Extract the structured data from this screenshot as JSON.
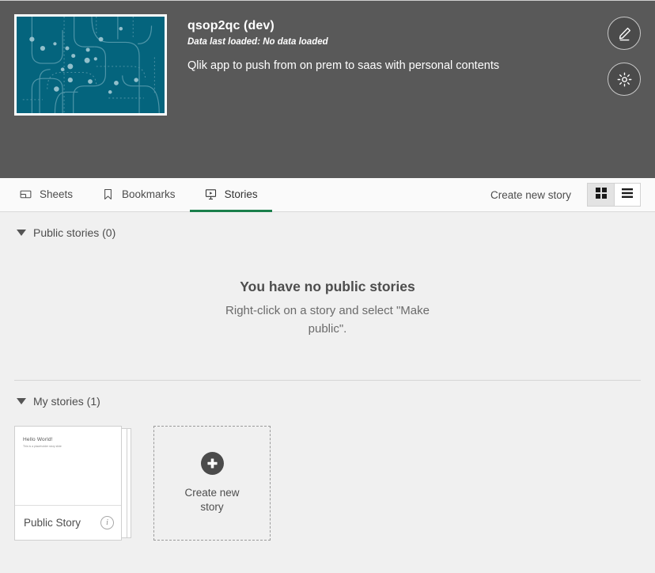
{
  "app": {
    "title": "qsop2qc (dev)",
    "last_loaded": "Data last loaded: No data loaded",
    "description": "Qlik app to push from on prem to saas with personal contents",
    "thumbnail_color": "#04647d",
    "actions": [
      {
        "name": "edit-app-button",
        "icon": "pencil-icon"
      },
      {
        "name": "app-settings-button",
        "icon": "gear-icon"
      }
    ]
  },
  "tabs": [
    {
      "label": "Sheets",
      "icon": "sheet-icon",
      "active": false
    },
    {
      "label": "Bookmarks",
      "icon": "bookmark-icon",
      "active": false
    },
    {
      "label": "Stories",
      "icon": "story-icon",
      "active": true
    }
  ],
  "toolbar": {
    "create_link": "Create new story",
    "grid_view_icon": "grid-view-icon",
    "list_view_icon": "list-view-icon",
    "active_view": "grid"
  },
  "public_section": {
    "heading": "Public stories (0)",
    "empty_title": "You have no public stories",
    "empty_subtitle": "Right-click on a story and select \"Make public\"."
  },
  "my_section": {
    "heading": "My stories (1)",
    "stories": [
      {
        "name": "Public Story",
        "thumb_title": "Hello World!",
        "thumb_subtitle": "This is a placeholder story slide",
        "info_icon": "info-icon"
      }
    ],
    "create_tile": {
      "label": "Create new story",
      "icon": "plus-icon"
    }
  },
  "colors": {
    "header_bg": "#595959",
    "accent_green": "#1a7f4b",
    "content_bg": "#f0f0f0"
  }
}
